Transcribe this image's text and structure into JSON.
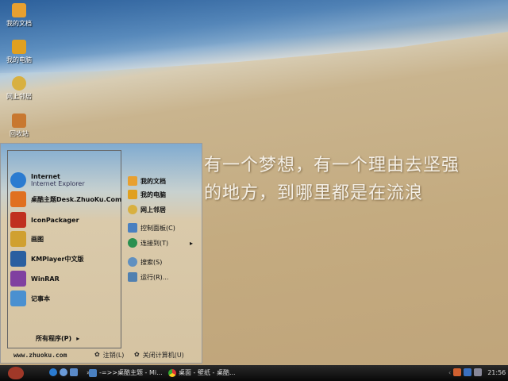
{
  "desktop": {
    "icons": [
      {
        "label": "我的文档",
        "icon": "folder-icon",
        "color": "#e8a030"
      },
      {
        "label": "我的电脑",
        "icon": "computer-icon",
        "color": "#e0a020"
      },
      {
        "label": "网上邻居",
        "icon": "network-icon",
        "color": "#d8b040"
      },
      {
        "label": "回收站",
        "icon": "recycle-bin-icon",
        "color": "#c87830"
      }
    ],
    "quote_line1": "有一个梦想，有一个理由去坚强",
    "quote_line2": "的地方，到哪里都是在流浪"
  },
  "start_menu": {
    "pinned": [
      {
        "label": "Internet",
        "sub": "Internet Explorer",
        "icon": "ie-icon",
        "color": "#2b7bd0"
      },
      {
        "label": "桌酷主题Desk.ZhuoKu.Com",
        "icon": "zhuoku-icon",
        "color": "#e07020"
      },
      {
        "label": "IconPackager",
        "icon": "iconpackager-icon",
        "color": "#c03020"
      },
      {
        "label": "画图",
        "icon": "paint-icon",
        "color": "#d0a030"
      },
      {
        "label": "KMPlayer中文版",
        "icon": "kmplayer-icon",
        "color": "#2a5fa0"
      },
      {
        "label": "WinRAR",
        "icon": "winrar-icon",
        "color": "#8040a0"
      },
      {
        "label": "记事本",
        "icon": "notepad-icon",
        "color": "#4a90d0"
      }
    ],
    "all_programs": "所有程序(P)",
    "right": [
      {
        "label": "我的文档",
        "icon": "folder-icon",
        "color": "#e8a030"
      },
      {
        "label": "我的电脑",
        "icon": "computer-icon",
        "color": "#e0a020"
      },
      {
        "label": "网上邻居",
        "icon": "network-icon",
        "color": "#d8b040"
      },
      {
        "label": "控制面板(C)",
        "icon": "control-panel-icon",
        "color": "#4a80c0"
      },
      {
        "label": "连接到(T)",
        "icon": "connect-icon",
        "color": "#2a9050",
        "arrow": "▸"
      },
      {
        "label": "搜索(S)",
        "icon": "search-icon",
        "color": "#6090c0"
      },
      {
        "label": "运行(R)...",
        "icon": "run-icon",
        "color": "#5080b0"
      }
    ],
    "website": "www.zhuoku.com",
    "logoff": "注销(L)",
    "shutdown": "关闭计算机(U)"
  },
  "taskbar": {
    "tasks": [
      {
        "label": "-=>>桌酷主题 - Mi...",
        "icon": "document-icon"
      },
      {
        "label": "桌面 - 壁纸 - 桌酷...",
        "icon": "chrome-icon"
      }
    ],
    "clock": "21:56",
    "expand": "»"
  }
}
